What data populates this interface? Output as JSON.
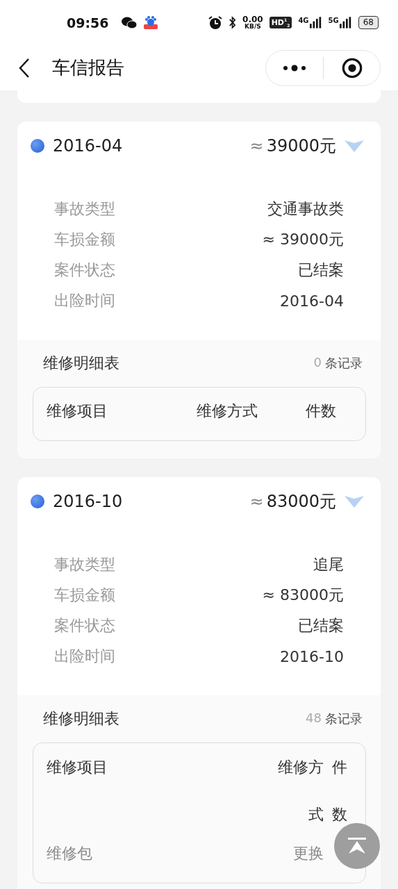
{
  "status_bar": {
    "time": "09:56",
    "speed_value": "0.00",
    "speed_unit": "KB/S",
    "hd": "HD$^{1}$$_{2}$",
    "networks": [
      "4G",
      "5G"
    ],
    "battery": "68"
  },
  "nav": {
    "title": "车信报告"
  },
  "records": [
    {
      "date": "2016-04",
      "approx": "≈",
      "amount": "39000元",
      "details": [
        {
          "label": "事故类型",
          "value": "交通事故类"
        },
        {
          "label": "车损金额",
          "value": "≈ 39000元"
        },
        {
          "label": "案件状态",
          "value": "已结案"
        },
        {
          "label": "出险时间",
          "value": "2016-04"
        }
      ],
      "repair": {
        "title": "维修明细表",
        "count": "0",
        "count_unit": "条记录",
        "columns": [
          "维修项目",
          "维修方式",
          "件数"
        ]
      }
    },
    {
      "date": "2016-10",
      "approx": "≈",
      "amount": "83000元",
      "details": [
        {
          "label": "事故类型",
          "value": "追尾"
        },
        {
          "label": "车损金额",
          "value": "≈ 83000元"
        },
        {
          "label": "案件状态",
          "value": "已结案"
        },
        {
          "label": "出险时间",
          "value": "2016-10"
        }
      ],
      "repair": {
        "title": "维修明细表",
        "count": "48",
        "count_unit": "条记录",
        "columns": [
          "维修项目",
          "维修方式",
          "件数"
        ],
        "rows": [
          {
            "item": "维修包",
            "method": "更换"
          }
        ]
      }
    }
  ]
}
